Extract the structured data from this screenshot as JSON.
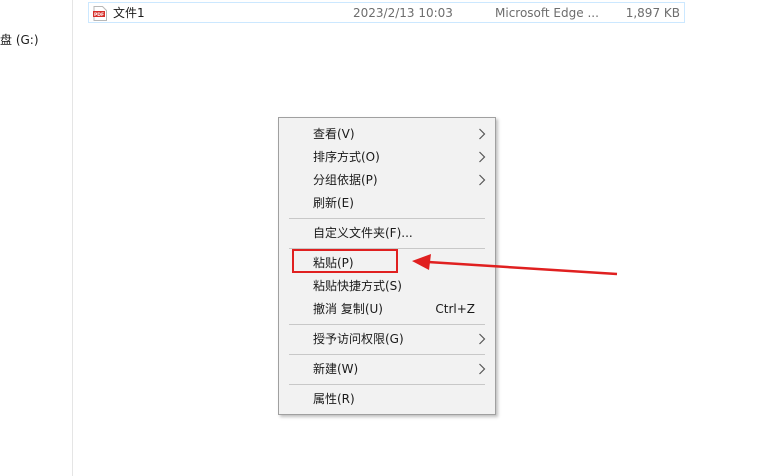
{
  "nav": {
    "drive_label": "盘 (G:)"
  },
  "file": {
    "icon": "pdf-file-icon",
    "icon_text": "PDF",
    "name": "文件1",
    "date": "2023/2/13 10:03",
    "type": "Microsoft Edge ...",
    "size": "1,897 KB"
  },
  "context_menu": {
    "items": [
      {
        "label": "查看(V)",
        "submenu": true
      },
      {
        "label": "排序方式(O)",
        "submenu": true
      },
      {
        "label": "分组依据(P)",
        "submenu": true
      },
      {
        "label": "刷新(E)",
        "submenu": false
      },
      {
        "label": "自定义文件夹(F)...",
        "submenu": false
      },
      {
        "label": "粘贴(P)",
        "submenu": false
      },
      {
        "label": "粘贴快捷方式(S)",
        "submenu": false
      },
      {
        "label": "撤消 复制(U)",
        "shortcut": "Ctrl+Z",
        "submenu": false
      },
      {
        "label": "授予访问权限(G)",
        "submenu": true
      },
      {
        "label": "新建(W)",
        "submenu": true
      },
      {
        "label": "属性(R)",
        "submenu": false
      }
    ]
  },
  "annotation": {
    "color": "#e02020",
    "target": "粘贴(P)"
  }
}
